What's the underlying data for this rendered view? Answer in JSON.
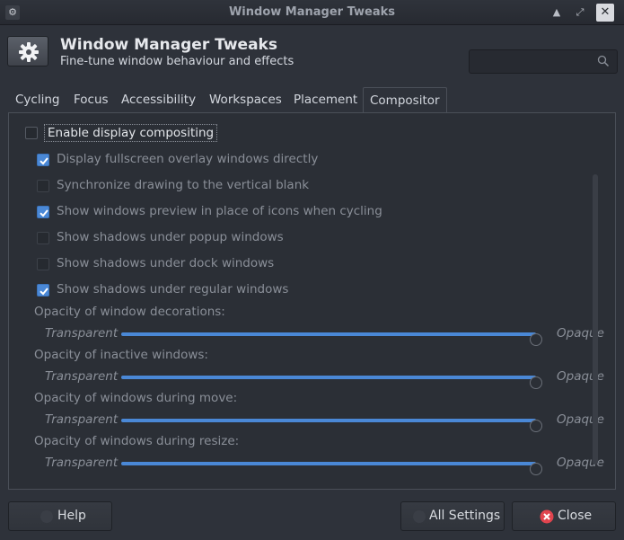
{
  "titlebar": {
    "title": "Window Manager Tweaks"
  },
  "header": {
    "title": "Window Manager Tweaks",
    "subtitle": "Fine-tune window behaviour and effects",
    "search": {
      "placeholder": "",
      "value": ""
    }
  },
  "tabs": [
    {
      "label": "Cycling",
      "active": false
    },
    {
      "label": "Focus",
      "active": false
    },
    {
      "label": "Accessibility",
      "active": false
    },
    {
      "label": "Workspaces",
      "active": false
    },
    {
      "label": "Placement",
      "active": false
    },
    {
      "label": "Compositor",
      "active": true
    }
  ],
  "compositor": {
    "enable": {
      "label": "Enable display compositing",
      "checked": false
    },
    "options": [
      {
        "label": "Display fullscreen overlay windows directly",
        "checked": true
      },
      {
        "label": "Synchronize drawing to the vertical blank",
        "checked": false
      },
      {
        "label": "Show windows preview in place of icons when cycling",
        "checked": true
      },
      {
        "label": "Show shadows under popup windows",
        "checked": false
      },
      {
        "label": "Show shadows under dock windows",
        "checked": false
      },
      {
        "label": "Show shadows under regular windows",
        "checked": true
      }
    ],
    "sliders": [
      {
        "title": "Opacity of window decorations:",
        "low": "Transparent",
        "high": "Opaque",
        "value": 1.0
      },
      {
        "title": "Opacity of inactive windows:",
        "low": "Transparent",
        "high": "Opaque",
        "value": 1.0
      },
      {
        "title": "Opacity of windows during move:",
        "low": "Transparent",
        "high": "Opaque",
        "value": 1.0
      },
      {
        "title": "Opacity of windows during resize:",
        "low": "Transparent",
        "high": "Opaque",
        "value": 1.0
      }
    ]
  },
  "footer": {
    "help": "Help",
    "all_settings": "All Settings",
    "close": "Close"
  },
  "colors": {
    "accent": "#4a88d6",
    "close_icon": "#e0444e"
  }
}
